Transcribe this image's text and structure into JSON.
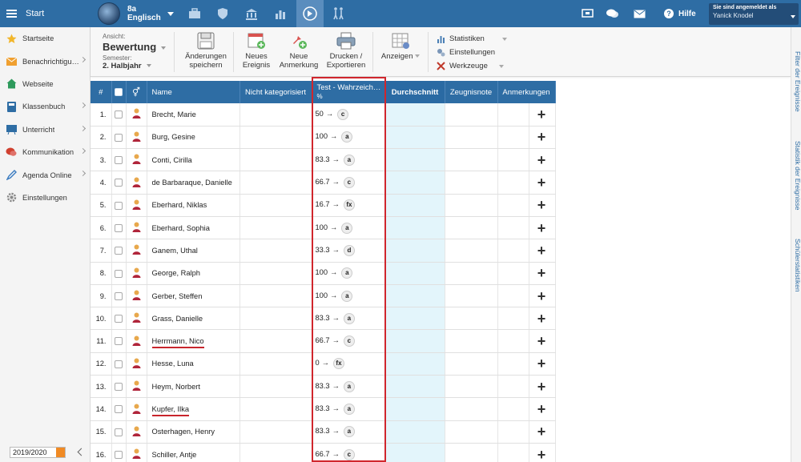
{
  "topbar": {
    "menu_label": "Start",
    "class_name": "8a",
    "class_subject": "Englisch",
    "help_label": "Hilfe",
    "user_caption": "Sie sind angemeldet als",
    "user_name": "Yanick Knodel"
  },
  "sidebar": {
    "items": [
      {
        "label": "Startseite",
        "icon": "star-icon",
        "color": "#f2b62b"
      },
      {
        "label": "Benachrichtigungen",
        "icon": "envelope-icon",
        "color": "#f0a030"
      },
      {
        "label": "Webseite",
        "icon": "house-icon",
        "color": "#2e9a5c"
      },
      {
        "label": "Klassenbuch",
        "icon": "book-icon",
        "color": "#2e6da4"
      },
      {
        "label": "Unterricht",
        "icon": "board-icon",
        "color": "#2e6da4"
      },
      {
        "label": "Kommunikation",
        "icon": "chat-icon",
        "color": "#d0402f"
      },
      {
        "label": "Agenda Online",
        "icon": "pen-icon",
        "color": "#3a7bc0"
      },
      {
        "label": "Einstellungen",
        "icon": "gear-icon",
        "color": "#888888"
      }
    ],
    "school_year": "2019/2020"
  },
  "toolbar": {
    "view_caption": "Ansicht:",
    "view_value": "Bewertung",
    "semester_caption": "Semester:",
    "semester_value": "2. Halbjahr",
    "save_label_1": "Änderungen",
    "save_label_2": "speichern",
    "new_event_1": "Neues",
    "new_event_2": "Ereignis",
    "new_note_1": "Neue",
    "new_note_2": "Anmerkung",
    "print_1": "Drucken /",
    "print_2": "Exportieren",
    "views_label": "Anzeigen",
    "stats_label": "Statistiken",
    "settings_label": "Einstellungen",
    "tools_label": "Werkzeuge"
  },
  "right_tabs": {
    "filter": "Filter der Ereignisse",
    "event_stats": "Statistik der Ereignisse",
    "student_stats": "Schülerstatistiken"
  },
  "table": {
    "headers": {
      "num": "#",
      "name": "Name",
      "uncategorized": "Nicht kategorisiert",
      "test": "Test - Wahrzeich…",
      "test_unit": "%",
      "average": "Durchschnitt",
      "report_grade": "Zeugnisnote",
      "remarks": "Anmerkungen"
    },
    "add_symbol": "+",
    "arrow": "→",
    "rows": [
      {
        "num": "1.",
        "name": "Brecht, Marie",
        "score": "50",
        "grade": "c"
      },
      {
        "num": "2.",
        "name": "Burg, Gesine",
        "score": "100",
        "grade": "a"
      },
      {
        "num": "3.",
        "name": "Conti, Cirilla",
        "score": "83.3",
        "grade": "a"
      },
      {
        "num": "4.",
        "name": "de Barbaraque, Danielle",
        "score": "66.7",
        "grade": "c"
      },
      {
        "num": "5.",
        "name": "Eberhard, Niklas",
        "score": "16.7",
        "grade": "fx"
      },
      {
        "num": "6.",
        "name": "Eberhard, Sophia",
        "score": "100",
        "grade": "a"
      },
      {
        "num": "7.",
        "name": "Ganem, Uthal",
        "score": "33.3",
        "grade": "d"
      },
      {
        "num": "8.",
        "name": "George, Ralph",
        "score": "100",
        "grade": "a"
      },
      {
        "num": "9.",
        "name": "Gerber, Steffen",
        "score": "100",
        "grade": "a"
      },
      {
        "num": "10.",
        "name": "Grass, Danielle",
        "score": "83.3",
        "grade": "a"
      },
      {
        "num": "11.",
        "name": "Herrmann, Nico",
        "score": "66.7",
        "grade": "c",
        "underline": true
      },
      {
        "num": "12.",
        "name": "Hesse, Luna",
        "score": "0",
        "grade": "fx"
      },
      {
        "num": "13.",
        "name": "Heym, Norbert",
        "score": "83.3",
        "grade": "a"
      },
      {
        "num": "14.",
        "name": "Kupfer, Ilka",
        "score": "83.3",
        "grade": "a",
        "underline": true
      },
      {
        "num": "15.",
        "name": "Osterhagen, Henry",
        "score": "83.3",
        "grade": "a"
      },
      {
        "num": "16.",
        "name": "Schiller, Antje",
        "score": "66.7",
        "grade": "c"
      }
    ]
  },
  "colors": {
    "primary": "#2e6da4",
    "average_column": "#e3f5fb",
    "highlight": "#d0262d"
  }
}
